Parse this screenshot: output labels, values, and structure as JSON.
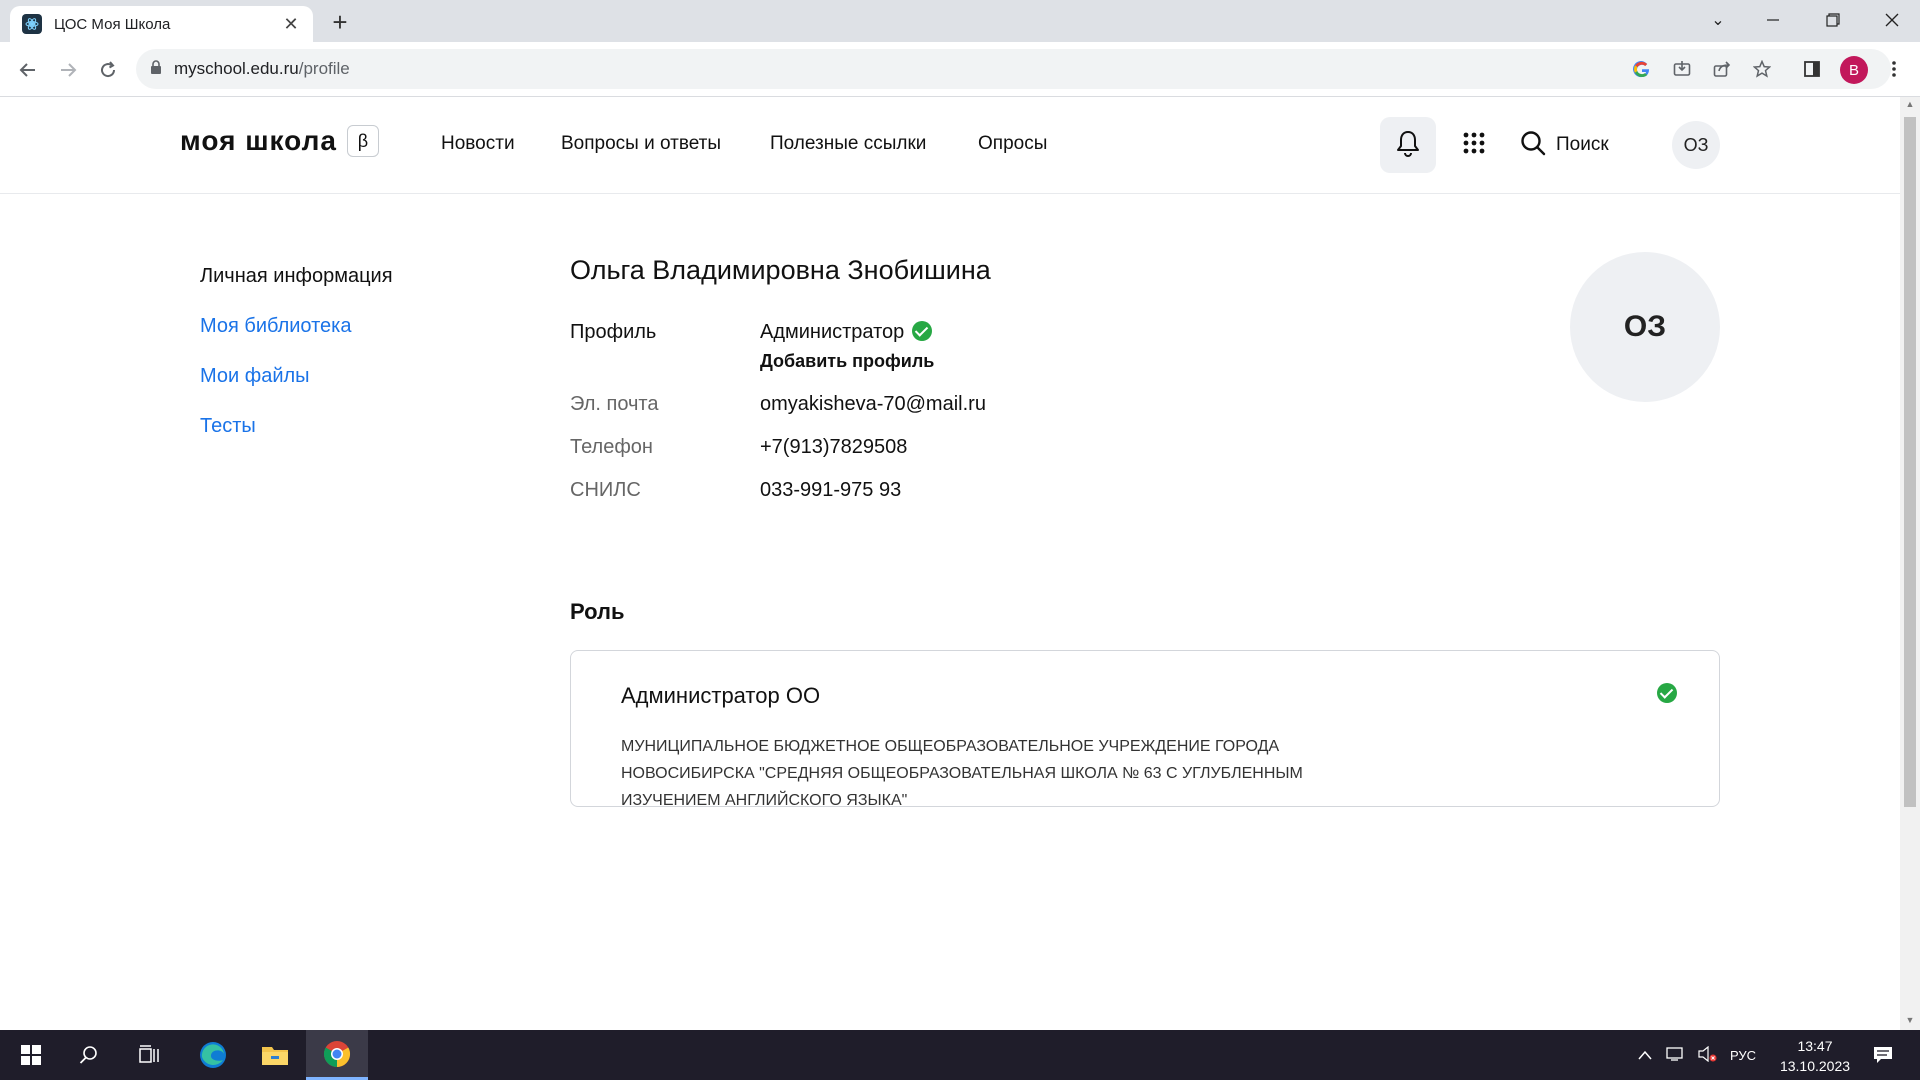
{
  "browser": {
    "tab_title": "ЦОС Моя Школа",
    "url_host": "myschool.edu.ru",
    "url_path": "/profile",
    "profile_initial": "B"
  },
  "site": {
    "logo": "моя школа",
    "beta": "β",
    "nav": [
      "Новости",
      "Вопросы и ответы",
      "Полезные ссылки",
      "Опросы"
    ],
    "search_label": "Поиск",
    "avatar_initials": "ОЗ"
  },
  "sidebar": {
    "items": [
      {
        "label": "Личная информация"
      },
      {
        "label": "Моя библиотека"
      },
      {
        "label": "Мои файлы"
      },
      {
        "label": "Тесты"
      }
    ]
  },
  "profile": {
    "full_name": "Ольга Владимировна Знобишина",
    "profile_label": "Профиль",
    "profile_value": "Администратор",
    "add_profile": "Добавить профиль",
    "email_label": "Эл. почта",
    "email_value": "omyakisheva-70@mail.ru",
    "phone_label": "Телефон",
    "phone_value": "+7(913)7829508",
    "snils_label": "СНИЛС",
    "snils_value": "033-991-975 93",
    "avatar_initials": "ОЗ"
  },
  "role": {
    "heading": "Роль",
    "title": "Администратор ОО",
    "organization": "МУНИЦИПАЛЬНОЕ БЮДЖЕТНОЕ ОБЩЕОБРАЗОВАТЕЛЬНОЕ УЧРЕЖДЕНИЕ ГОРОДА НОВОСИБИРСКА \"СРЕДНЯЯ ОБЩЕОБРАЗОВАТЕЛЬНАЯ ШКОЛА № 63 С УГЛУБЛЕННЫМ ИЗУЧЕНИЕМ АНГЛИЙСКОГО ЯЗЫКА\""
  },
  "taskbar": {
    "language": "РУС",
    "time": "13:47",
    "date": "13.10.2023"
  },
  "colors": {
    "link": "#1a73e8",
    "verified": "#27a844",
    "avatar_bg": "#eef0f3"
  }
}
